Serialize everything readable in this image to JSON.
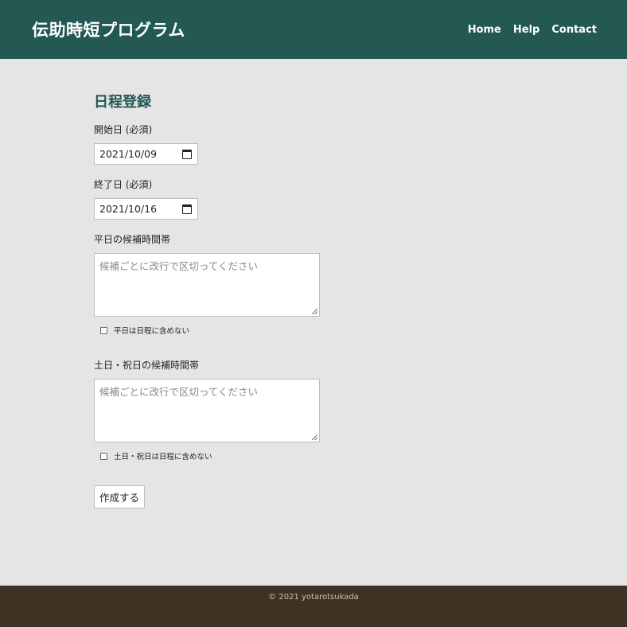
{
  "header": {
    "title": "伝助時短プログラム",
    "nav": [
      "Home",
      "Help",
      "Contact"
    ]
  },
  "form": {
    "title": "日程登録",
    "start_label": "開始日 (必須)",
    "start_value": "2021/10/09",
    "end_label": "終了日 (必須)",
    "end_value": "2021/10/16",
    "weekday_label": "平日の候補時間帯",
    "weekday_placeholder": "候補ごとに改行で区切ってください",
    "weekday_exclude": "平日は日程に含めない",
    "weekend_label": "土日・祝日の候補時間帯",
    "weekend_placeholder": "候補ごとに改行で区切ってください",
    "weekend_exclude": "土日・祝日は日程に含めない",
    "submit": "作成する"
  },
  "footer": {
    "copyright": "© 2021 yotarotsukada"
  },
  "colors": {
    "header": "#245853",
    "footer": "#3d3223",
    "background": "#e5e5e5"
  }
}
